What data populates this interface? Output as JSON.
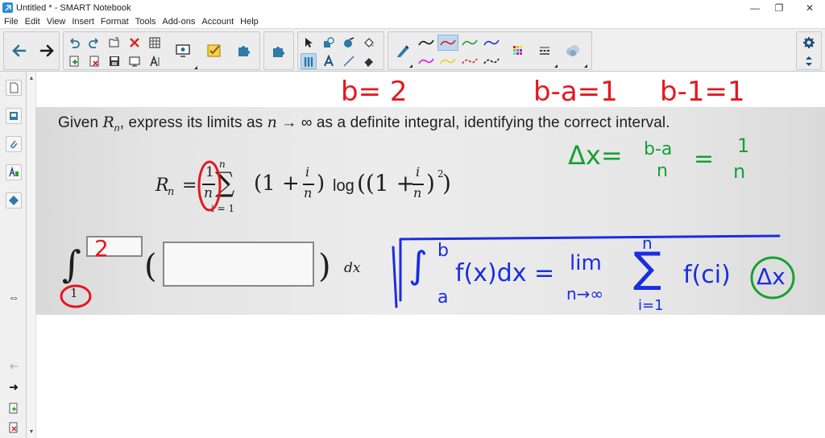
{
  "window": {
    "title": "Untitled * - SMART Notebook",
    "minimize": "—",
    "restore": "❐",
    "close": "✕"
  },
  "menu": [
    "File",
    "Edit",
    "View",
    "Insert",
    "Format",
    "Tools",
    "Add-ons",
    "Account",
    "Help"
  ],
  "sidebar": {
    "expand": "⇔"
  },
  "problem": {
    "prompt_start": "Given ",
    "prompt_var": "R",
    "prompt_sub": "n",
    "prompt_mid": ", express its limits as ",
    "prompt_n": "n",
    "prompt_arrow": " → ∞ ",
    "prompt_end": "as a definite integral, identifying the correct interval.",
    "formula": {
      "lhs": "R",
      "lhs_sub": "n",
      "equals": "=",
      "frac_num": "1",
      "frac_den": "n",
      "sigma": "∑",
      "sum_top": "n",
      "sum_bottom": "i = 1",
      "body_open": "(1 + ",
      "body_i": "i",
      "body_n": "n",
      "body_close": ")",
      "log": "log",
      "log_open": "((1 + ",
      "log_i": "i",
      "log_n": "n",
      "log_close": ")",
      "log_power": "2",
      "log_end": ")"
    },
    "integral_sign": "∫",
    "upper_limit": "",
    "lower_limit": "1",
    "paren_open": "(",
    "paren_close": ")",
    "dx": "dx"
  },
  "annotations": {
    "b_eq": "b= 2",
    "b_minus_a": "b-a=1",
    "b_minus_1": "b-1=1",
    "delta_x": "Δx=",
    "frac_ba": "b-a",
    "frac_n": "n",
    "eq2": "=",
    "frac_1": "1",
    "frac_n2": "n",
    "upper_handwritten": "2",
    "riemann": {
      "int": "∫",
      "upper": "b",
      "lower": "a",
      "fx": "f(x)dx =",
      "lim": "lim",
      "lim_sub": "n→∞",
      "sigma": "∑",
      "sigma_top": "n",
      "sigma_bottom": "i=1",
      "fci": "f(ci)",
      "dx": "Δx"
    }
  },
  "colors": {
    "red_ink": "#e4181f",
    "green_ink": "#16a133",
    "blue_ink": "#1a2de0"
  }
}
